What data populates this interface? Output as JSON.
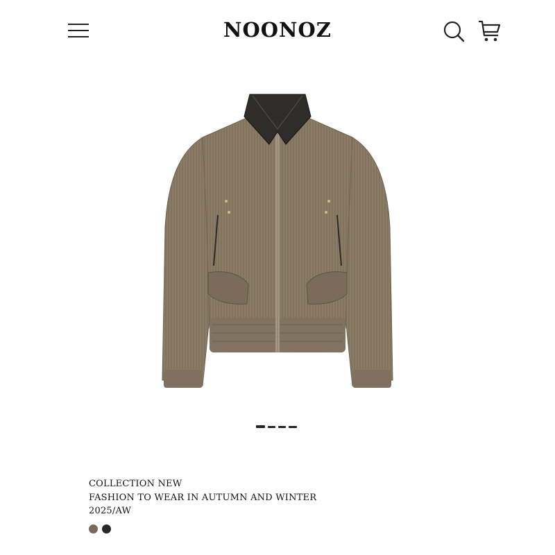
{
  "header": {
    "brand": "NOONOZ",
    "menu_icon": "hamburger-menu-icon",
    "search_icon": "search-icon",
    "cart_icon": "cart-icon"
  },
  "carousel": {
    "image_alt": "jacket",
    "slide_count": 4
  },
  "collection": {
    "line1": "COLLECTION NEW",
    "line2": "FASHION TO WEAR IN AUTUMN AND WINTER",
    "line3": "2025/AW"
  },
  "colors": {
    "swatches": [
      "#7a6b58",
      "#2a2826"
    ]
  }
}
